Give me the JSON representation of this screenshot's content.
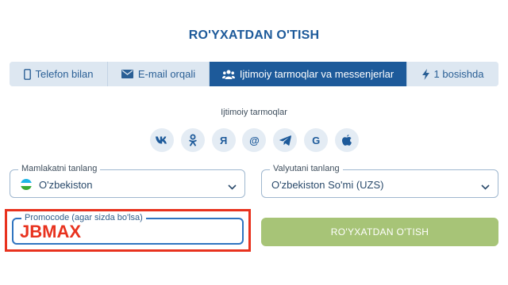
{
  "page": {
    "title": "RO'YXATDAN O'TISH"
  },
  "tabs": [
    {
      "label": "Telefon bilan",
      "icon": "phone-icon"
    },
    {
      "label": "E-mail orqali",
      "icon": "envelope-icon"
    },
    {
      "label": "Ijtimoiy tarmoqlar va messenjerlar",
      "icon": "users-icon",
      "active": true
    },
    {
      "label": "1 bosishda",
      "icon": "lightning-icon"
    }
  ],
  "social": {
    "label": "Ijtimoiy tarmoqlar",
    "networks": [
      {
        "name": "vk-icon",
        "glyph": "vk"
      },
      {
        "name": "odnoklassniki-icon",
        "glyph": "ok"
      },
      {
        "name": "yandex-icon",
        "glyph": "Я"
      },
      {
        "name": "mailru-icon",
        "glyph": "@"
      },
      {
        "name": "telegram-icon",
        "glyph": "tg"
      },
      {
        "name": "google-icon",
        "glyph": "G"
      },
      {
        "name": "apple-icon",
        "glyph": "apple"
      }
    ]
  },
  "form": {
    "country": {
      "label": "Mamlakatni tanlang",
      "value": "O'zbekiston",
      "flag": "uzbekistan-flag-icon"
    },
    "currency": {
      "label": "Valyutani tanlang",
      "value": "O'zbekiston So'mi (UZS)"
    },
    "promo": {
      "label": "Promocode (agar sizda bo'lsa)",
      "value": "JBMAX"
    },
    "submit_label": "RO'YXATDAN O'TISH"
  },
  "colors": {
    "accent": "#1d5a9a",
    "tab_inactive": "#dde7f1",
    "submit": "#a7c477",
    "highlight": "#e8321e"
  }
}
